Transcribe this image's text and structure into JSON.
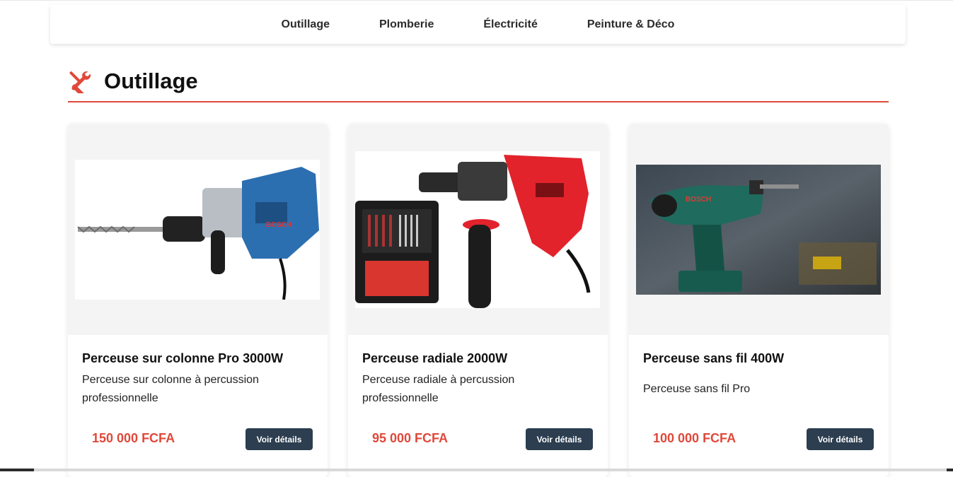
{
  "nav": {
    "items": [
      {
        "label": "Outillage"
      },
      {
        "label": "Plomberie"
      },
      {
        "label": "Électricité"
      },
      {
        "label": "Peinture & Déco"
      }
    ]
  },
  "section": {
    "title": "Outillage",
    "icon": "tools-icon",
    "accent_color": "#e0483a"
  },
  "products": [
    {
      "name": "Perceuse sur colonne Pro 3000W",
      "description": "Perceuse sur colonne à percussion professionnelle",
      "price": "150 000 FCFA",
      "button": "Voir détails",
      "image": "rotary-hammer-drill-image"
    },
    {
      "name": "Perceuse radiale 2000W",
      "description": "Perceuse radiale à percussion professionnelle",
      "price": "95 000 FCFA",
      "button": "Voir détails",
      "image": "impact-drill-kit-image"
    },
    {
      "name": "Perceuse sans fil 400W",
      "description": "Perceuse sans fil Pro",
      "price": "100 000 FCFA",
      "button": "Voir détails",
      "image": "cordless-drill-image"
    }
  ],
  "colors": {
    "price": "#e0483a",
    "button_bg": "#2c3e50",
    "button_text": "#ffffff"
  }
}
